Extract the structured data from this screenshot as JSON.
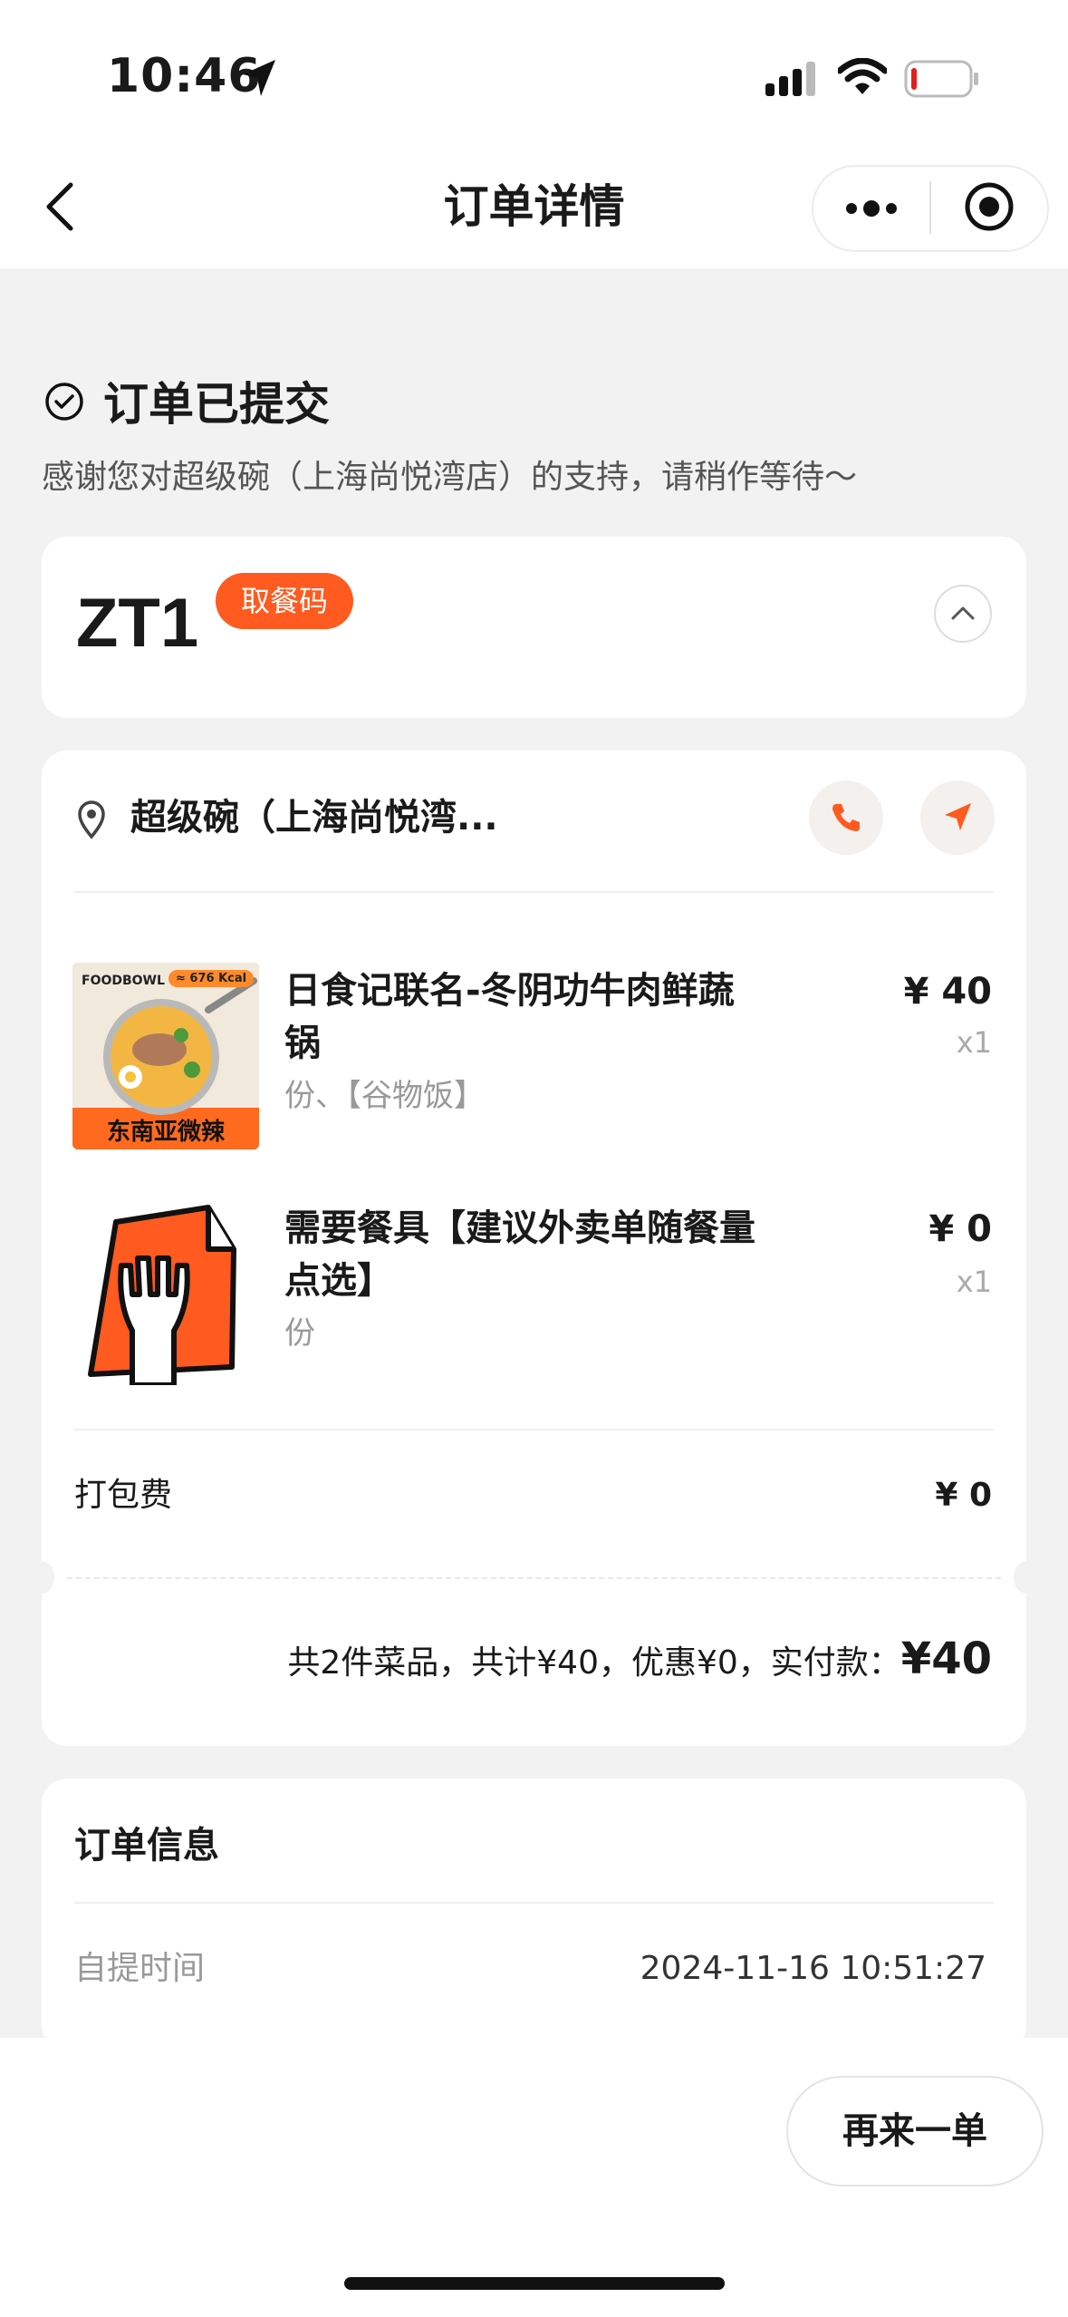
{
  "status_bar": {
    "time": "10:46"
  },
  "nav": {
    "title": "订单详情"
  },
  "status": {
    "title": "订单已提交",
    "subtitle": "感谢您对超级碗（上海尚悦湾店）的支持，请稍作等待～"
  },
  "pickup": {
    "code": "ZT1",
    "badge": "取餐码"
  },
  "store": {
    "name": "超级碗（上海尚悦湾..."
  },
  "items": [
    {
      "name": "日食记联名-冬阴功牛肉鲜蔬锅",
      "spec": "份、【谷物饭】",
      "price": "¥ 40",
      "qty": "x1",
      "image_brand": "FOODBOWL",
      "image_kcal": "≈ 676 Kcal",
      "image_tag": "东南亚微辣"
    },
    {
      "name": "需要餐具【建议外卖单随餐量点选】",
      "spec": "份",
      "price": "¥ 0",
      "qty": "x1"
    }
  ],
  "fee": {
    "label": "打包费",
    "value": "¥ 0"
  },
  "summary": {
    "text": "共2件菜品，共计¥40，优惠¥0，实付款：",
    "total": "¥40"
  },
  "order_info": {
    "title": "订单信息",
    "pickup_time_label": "自提时间",
    "pickup_time_value": "2024-11-16 10:51:27"
  },
  "actions": {
    "reorder": "再来一单"
  },
  "colors": {
    "accent": "#ff5a1f",
    "background": "#f2f2f2"
  }
}
